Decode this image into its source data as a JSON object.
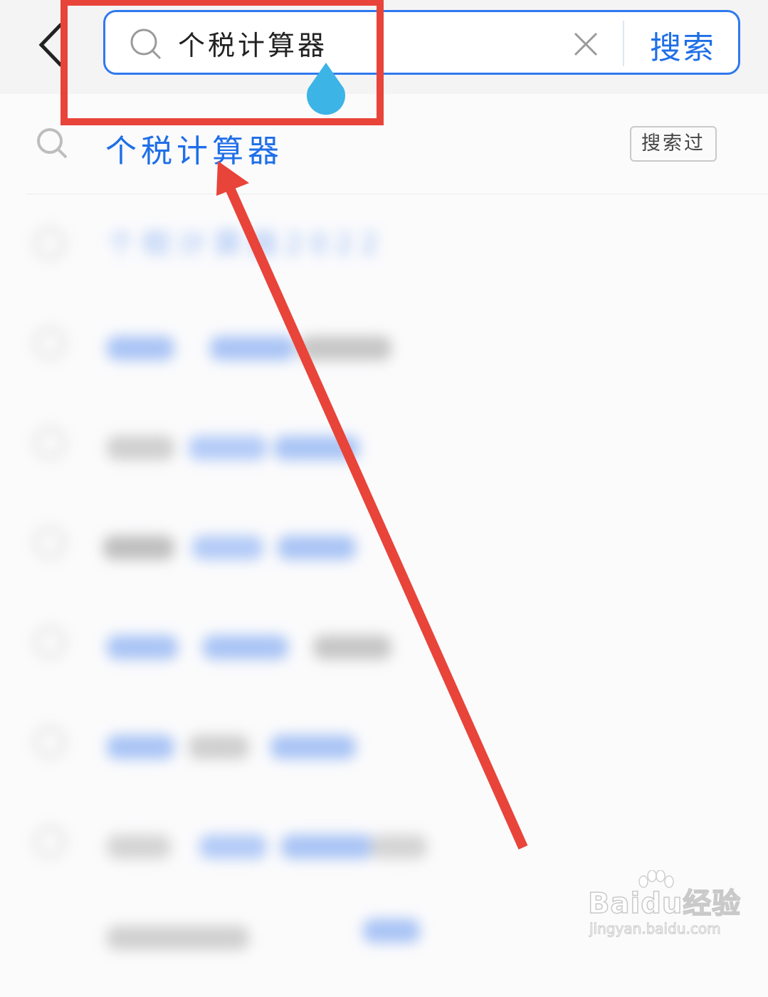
{
  "search": {
    "query": "个税计算器",
    "submit_label": "搜索"
  },
  "first_suggestion": {
    "text": "个税计算器",
    "tag": "搜索过"
  },
  "blurred_suggestions": [
    "个税计算器2022"
  ],
  "watermark": {
    "brand": "Baidu经验",
    "url": "jingyan.baidu.com"
  },
  "colors": {
    "accent": "#1f6fe8",
    "annotation": "#e8443a",
    "cursor_handle": "#3db4e6"
  }
}
